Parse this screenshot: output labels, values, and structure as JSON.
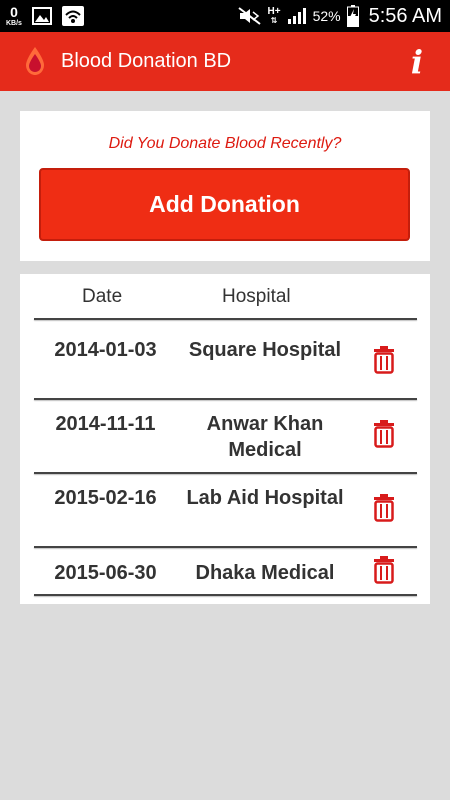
{
  "status_bar": {
    "speed_value": "0",
    "speed_unit": "KB/s",
    "network": "H+",
    "battery_percent": "52%",
    "time": "5:56 AM"
  },
  "app_bar": {
    "title": "Blood Donation BD",
    "info_label": "i"
  },
  "donate_card": {
    "prompt": "Did You Donate Blood Recently?",
    "add_button_label": "Add Donation"
  },
  "donations_table": {
    "headers": {
      "date": "Date",
      "hospital": "Hospital"
    },
    "rows": [
      {
        "date": "2014-01-03",
        "hospital": "Square Hospital"
      },
      {
        "date": "2014-11-11",
        "hospital": "Anwar Khan Medical"
      },
      {
        "date": "2015-02-16",
        "hospital": "Lab Aid Hospital"
      },
      {
        "date": "2015-06-30",
        "hospital": "Dhaka Medical"
      }
    ]
  },
  "colors": {
    "accent": "#e52b1b",
    "button": "#ef2d14",
    "delete_icon": "#d81b1b"
  },
  "icons": {
    "app_logo": "blood-drop-icon",
    "info": "info-icon",
    "delete": "trash-icon"
  }
}
